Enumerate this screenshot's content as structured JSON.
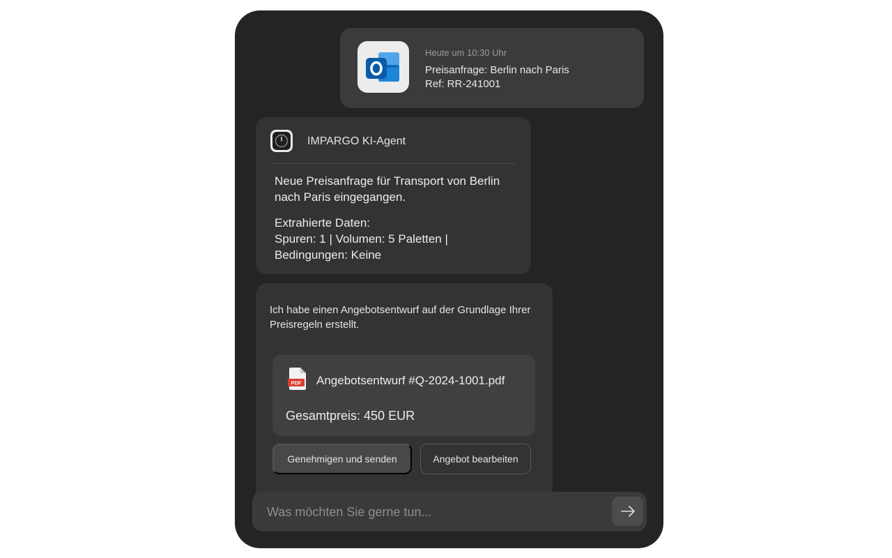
{
  "email": {
    "timestamp": "Heute um 10:30 Uhr",
    "subject": "Preisanfrage: Berlin nach Paris",
    "ref": "Ref: RR-241001",
    "icon": "outlook-icon",
    "accent": "#0f6cbd"
  },
  "agent": {
    "name": "IMPARGO KI-Agent",
    "icon": "impargo-logo-icon",
    "message": "Neue Preisanfrage für Transport von Berlin nach Paris eingegangen.",
    "extract_title": "Extrahierte Daten:",
    "extract_line1": "Spuren: 1 | Volumen: 5 Paletten |",
    "extract_line2": "Bedingungen: Keine"
  },
  "draft": {
    "message": "Ich habe einen Angebotsentwurf auf der Grundlage Ihrer Preisregeln erstellt.",
    "file_name": "Angebotsentwurf #Q-2024-1001.pdf",
    "file_icon": "pdf-file-icon",
    "file_icon_label": "PDF",
    "total": "Gesamtpreis: 450 EUR",
    "approve_label": "Genehmigen und senden",
    "edit_label": "Angebot bearbeiten"
  },
  "composer": {
    "placeholder": "Was möchten Sie gerne tun...",
    "value": "",
    "send_icon": "arrow-right-icon"
  }
}
